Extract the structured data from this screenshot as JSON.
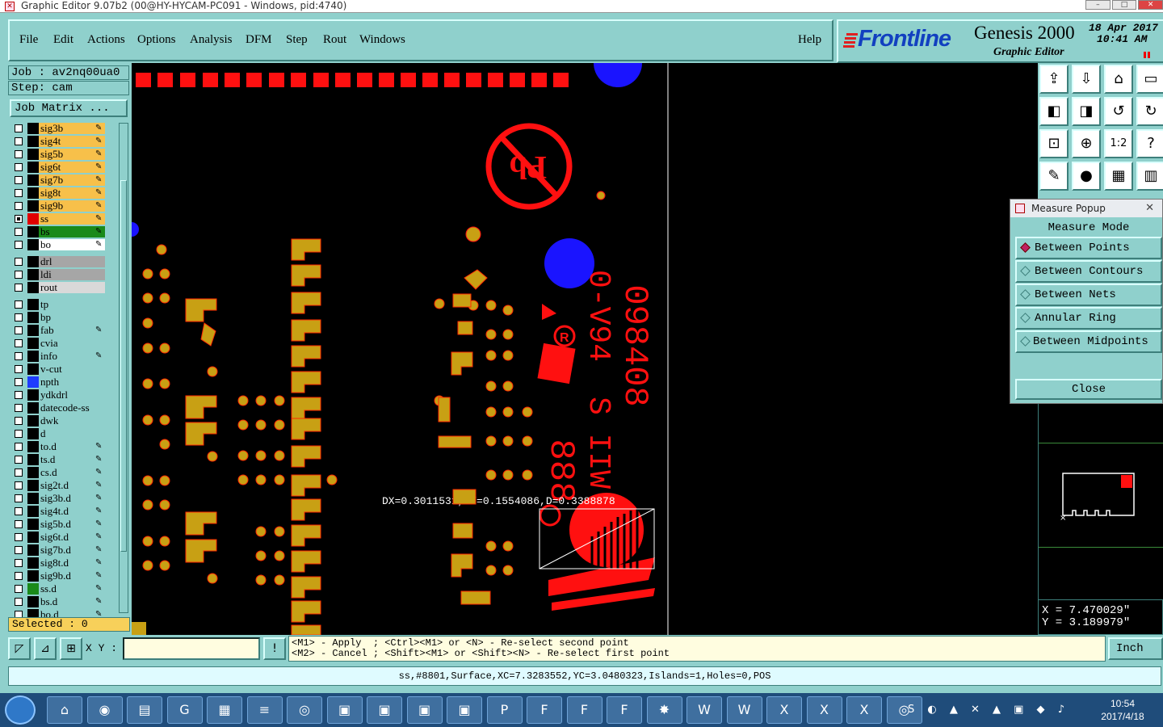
{
  "window": {
    "title": "Graphic Editor 9.07b2 (00@HY-HYCAM-PC091 - Windows, pid:4740)",
    "controls": [
      "–",
      "□",
      "✕"
    ]
  },
  "menu": {
    "items": [
      "File",
      "Edit",
      "Actions",
      "Options",
      "Analysis",
      "DFM",
      "Step",
      "Rout",
      "Windows"
    ],
    "help": "Help"
  },
  "brand": {
    "logo": "Frontline",
    "product": "Genesis 2000",
    "subtitle": "Graphic Editor",
    "date": "18 Apr 2017",
    "time": "10:41 AM"
  },
  "job": {
    "job_label": "Job : av2nq00ua0",
    "step_label": "Step: cam",
    "matrix_button": "Job Matrix ..."
  },
  "layers": [
    {
      "name": "sig3b",
      "bg": "#f7c04a",
      "sw": "#000",
      "edit": true,
      "on": false
    },
    {
      "name": "sig4t",
      "bg": "#f7c04a",
      "sw": "#000",
      "edit": true,
      "on": false
    },
    {
      "name": "sig5b",
      "bg": "#f7c04a",
      "sw": "#000",
      "edit": true,
      "on": false
    },
    {
      "name": "sig6t",
      "bg": "#f7c04a",
      "sw": "#000",
      "edit": true,
      "on": false
    },
    {
      "name": "sig7b",
      "bg": "#f7c04a",
      "sw": "#000",
      "edit": true,
      "on": false
    },
    {
      "name": "sig8t",
      "bg": "#f7c04a",
      "sw": "#000",
      "edit": true,
      "on": false
    },
    {
      "name": "sig9b",
      "bg": "#f7c04a",
      "sw": "#000",
      "edit": true,
      "on": false
    },
    {
      "name": "ss",
      "bg": "#f7c04a",
      "sw": "#e00000",
      "edit": true,
      "on": true
    },
    {
      "name": "bs",
      "bg": "#1a8a1a",
      "sw": "#000",
      "edit": true,
      "on": false
    },
    {
      "name": "bo",
      "bg": "#ffffff",
      "sw": "#000",
      "edit": true,
      "on": false
    },
    {
      "name": "drl",
      "bg": "#a6a6a6",
      "sw": "#000",
      "edit": false,
      "on": false,
      "gap": true
    },
    {
      "name": "ldi",
      "bg": "#a6a6a6",
      "sw": "#000",
      "edit": false,
      "on": false
    },
    {
      "name": "rout",
      "bg": "#d9d9d9",
      "sw": "#000",
      "edit": false,
      "on": false
    },
    {
      "name": "tp",
      "bg": "#8fd0cc",
      "sw": "#000",
      "edit": false,
      "on": false,
      "gap": true
    },
    {
      "name": "bp",
      "bg": "#8fd0cc",
      "sw": "#000",
      "edit": false,
      "on": false
    },
    {
      "name": "fab",
      "bg": "#8fd0cc",
      "sw": "#000",
      "edit": true,
      "on": false
    },
    {
      "name": "cvia",
      "bg": "#8fd0cc",
      "sw": "#000",
      "edit": false,
      "on": false
    },
    {
      "name": "info",
      "bg": "#8fd0cc",
      "sw": "#000",
      "edit": true,
      "on": false
    },
    {
      "name": "v-cut",
      "bg": "#8fd0cc",
      "sw": "#000",
      "edit": false,
      "on": false
    },
    {
      "name": "npth",
      "bg": "#8fd0cc",
      "sw": "#1e3cff",
      "edit": false,
      "on": false
    },
    {
      "name": "ydkdrl",
      "bg": "#8fd0cc",
      "sw": "#000",
      "edit": false,
      "on": false
    },
    {
      "name": "datecode-ss",
      "bg": "#8fd0cc",
      "sw": "#000",
      "edit": false,
      "on": false
    },
    {
      "name": "dwk",
      "bg": "#8fd0cc",
      "sw": "#000",
      "edit": false,
      "on": false
    },
    {
      "name": "d",
      "bg": "#8fd0cc",
      "sw": "#000",
      "edit": false,
      "on": false
    },
    {
      "name": "to.d",
      "bg": "#8fd0cc",
      "sw": "#000",
      "edit": true,
      "on": false
    },
    {
      "name": "ts.d",
      "bg": "#8fd0cc",
      "sw": "#000",
      "edit": true,
      "on": false
    },
    {
      "name": "cs.d",
      "bg": "#8fd0cc",
      "sw": "#000",
      "edit": true,
      "on": false
    },
    {
      "name": "sig2t.d",
      "bg": "#8fd0cc",
      "sw": "#000",
      "edit": true,
      "on": false
    },
    {
      "name": "sig3b.d",
      "bg": "#8fd0cc",
      "sw": "#000",
      "edit": true,
      "on": false
    },
    {
      "name": "sig4t.d",
      "bg": "#8fd0cc",
      "sw": "#000",
      "edit": true,
      "on": false
    },
    {
      "name": "sig5b.d",
      "bg": "#8fd0cc",
      "sw": "#000",
      "edit": true,
      "on": false
    },
    {
      "name": "sig6t.d",
      "bg": "#8fd0cc",
      "sw": "#000",
      "edit": true,
      "on": false
    },
    {
      "name": "sig7b.d",
      "bg": "#8fd0cc",
      "sw": "#000",
      "edit": true,
      "on": false
    },
    {
      "name": "sig8t.d",
      "bg": "#8fd0cc",
      "sw": "#000",
      "edit": true,
      "on": false
    },
    {
      "name": "sig9b.d",
      "bg": "#8fd0cc",
      "sw": "#000",
      "edit": true,
      "on": false
    },
    {
      "name": "ss.d",
      "bg": "#8fd0cc",
      "sw": "#1a8a1a",
      "edit": true,
      "on": false
    },
    {
      "name": "bs.d",
      "bg": "#8fd0cc",
      "sw": "#000",
      "edit": true,
      "on": false
    },
    {
      "name": "bo.d",
      "bg": "#8fd0cc",
      "sw": "#000",
      "edit": true,
      "on": false
    }
  ],
  "selected": "Selected : 0",
  "canvas": {
    "measure_label": "DX=0.3011531,DY=0.1554086,D=0.3388878",
    "silk_text_1": "098408",
    "silk_text_2": "0-V94",
    "silk_text_3": "S IIW",
    "silk_text_4": "888",
    "colors": {
      "pad": "#c8a014",
      "silk": "#ff1010",
      "hole": "#1a14ff",
      "background": "#000000"
    }
  },
  "toolbox": {
    "icons": [
      "home-top",
      "home-down",
      "home",
      "window",
      "pan-left",
      "pan-right",
      "undo-view",
      "redo-view",
      "zoom-fit",
      "zoom-center",
      "scale-1-2",
      "help",
      "measure-tool",
      "snap-tool",
      "layer-1",
      "layer-2"
    ],
    "glyphs": [
      "⇪",
      "⇩",
      "⌂",
      "▭",
      "◧",
      "◨",
      "↺",
      "↻",
      "⊡",
      "⊕",
      "1:2",
      "?",
      "✎",
      "●",
      "▦",
      "▥"
    ]
  },
  "measure_popup": {
    "title": "Measure Popup",
    "mode_label": "Measure Mode",
    "options": [
      "Between Points",
      "Between Contours",
      "Between Nets",
      "Annular Ring",
      "Between Midpoints"
    ],
    "selected": "Between Points",
    "close": "Close"
  },
  "coords": {
    "x": "X = 7.470029\"",
    "y": "Y = 3.189979\""
  },
  "command": {
    "xy_label": "X Y :",
    "xy_value": "",
    "hint_line_1": "<M1> - Apply  ; <Ctrl><M1> or <N> - Re-select second point",
    "hint_line_2": "<M2> - Cancel ; <Shift><M1> or <Shift><N> - Re-select first point",
    "unit": "Inch"
  },
  "status": "ss,#8801,Surface,XC=7.3283552,YC=3.0480323,Islands=1,Holes=0,POS",
  "taskbar": {
    "apps": [
      "explorer",
      "chrome",
      "save",
      "genesis",
      "calculator",
      "notepad",
      "network",
      "editor-1",
      "editor-2",
      "editor-3",
      "editor-4",
      "p-app",
      "frontline-1",
      "frontline-2",
      "frontline-3",
      "shell",
      "word-1",
      "word-2",
      "excel-1",
      "excel-2",
      "excel-3",
      "network-2"
    ],
    "clock_time": "10:54",
    "clock_date": "2017/4/18"
  }
}
